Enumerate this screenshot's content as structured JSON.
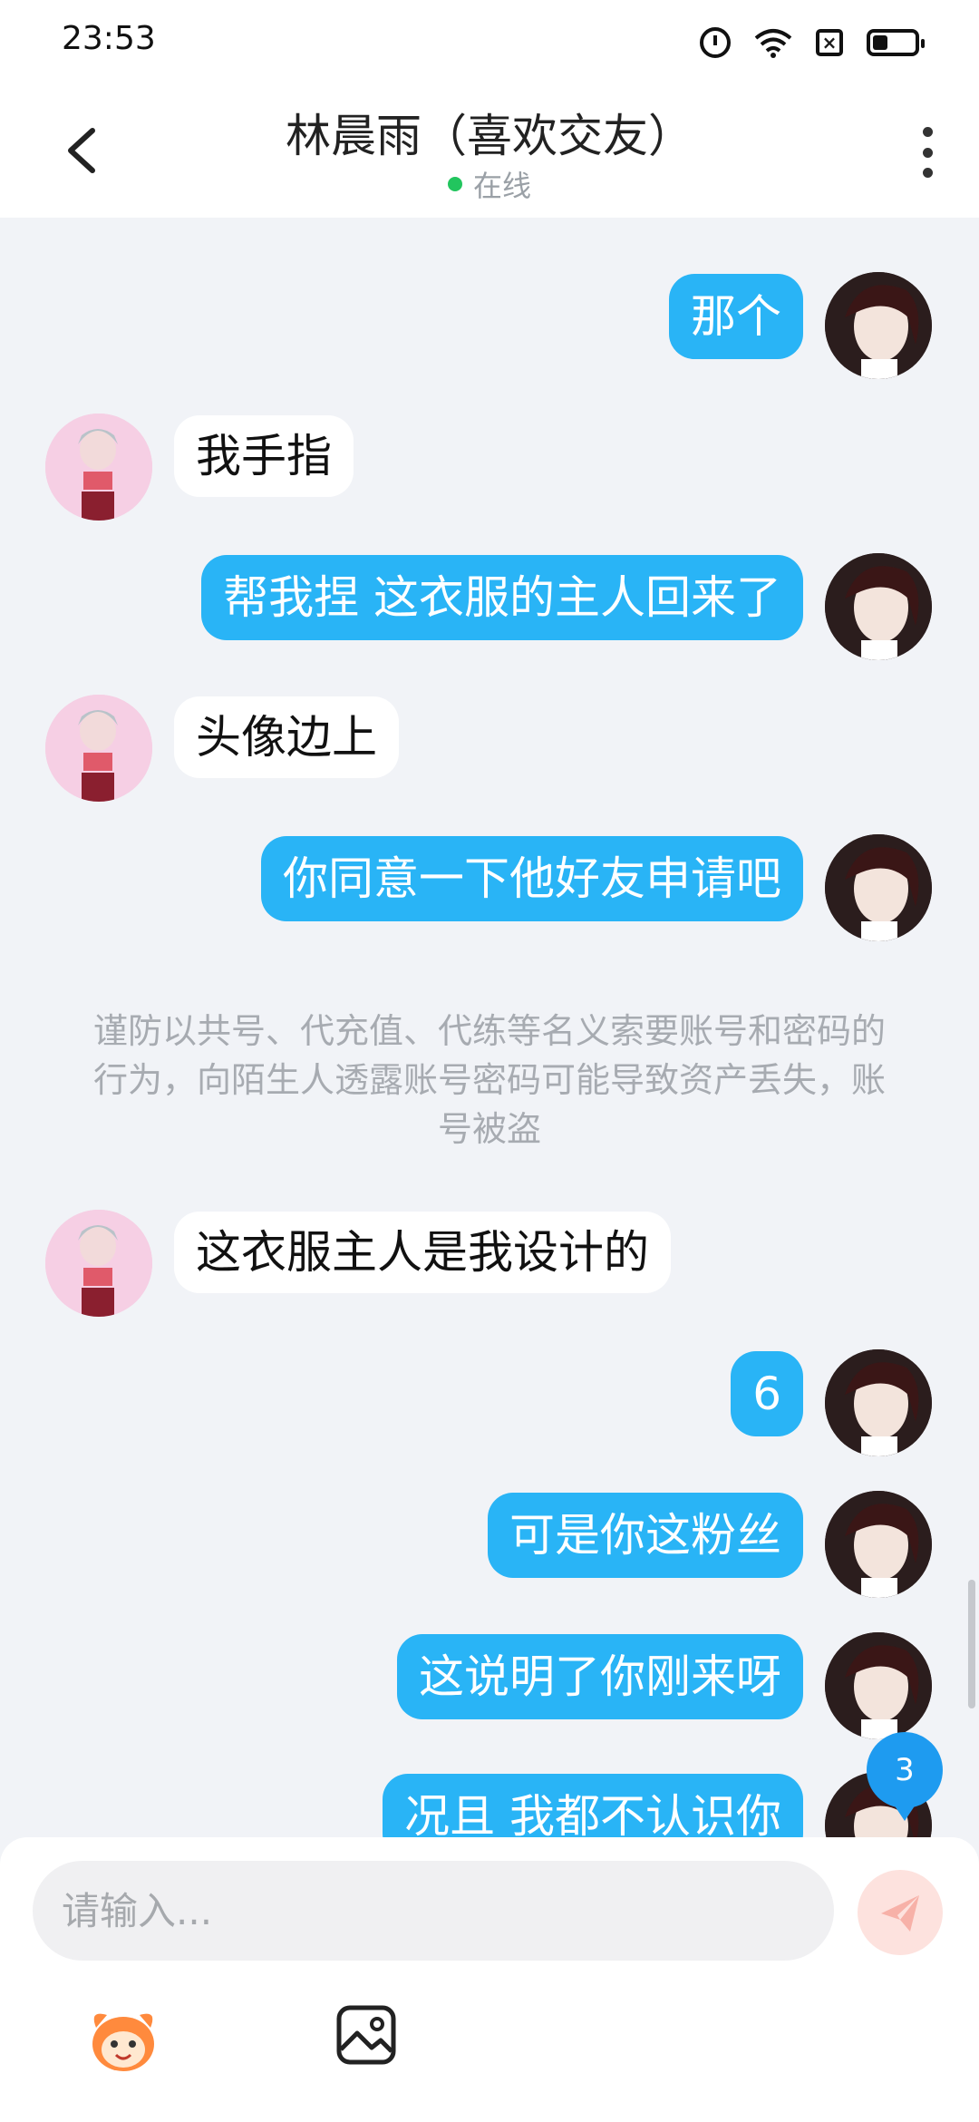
{
  "status_bar": {
    "time": "23:53",
    "icons": [
      "alarm-icon",
      "wifi-icon",
      "sim-x-icon",
      "battery-icon"
    ],
    "battery_level": 0.3
  },
  "header": {
    "title": "林晨雨（喜欢交友）",
    "status": "在线",
    "status_color": "#22c55e"
  },
  "messages": [
    {
      "sender": "me",
      "text": "那个"
    },
    {
      "sender": "friend",
      "text": "我手指"
    },
    {
      "sender": "me",
      "text": "帮我捏 这衣服的主人回来了"
    },
    {
      "sender": "friend",
      "text": "头像边上"
    },
    {
      "sender": "me",
      "text": "你同意一下他好友申请吧"
    },
    {
      "sender": "system",
      "text": "谨防以共号、代充值、代练等名义索要账号和密码的行为，向陌生人透露账号密码可能导致资产丢失，账号被盗"
    },
    {
      "sender": "friend",
      "text": "这衣服主人是我设计的"
    },
    {
      "sender": "me",
      "text": "6"
    },
    {
      "sender": "me",
      "text": "可是你这粉丝"
    },
    {
      "sender": "me",
      "text": "这说明了你刚来呀"
    },
    {
      "sender": "me",
      "text": "况且 我都不认识你"
    }
  ],
  "unread_badge": "3",
  "input": {
    "placeholder": "请输入...",
    "value": ""
  },
  "colors": {
    "outgoing_bubble": "#29b4f6",
    "incoming_bubble": "#ffffff",
    "background": "#f1f3f7",
    "send_button": "#fde2de"
  },
  "toolbar": {
    "icons": [
      "sticker-icon",
      "image-icon"
    ]
  }
}
